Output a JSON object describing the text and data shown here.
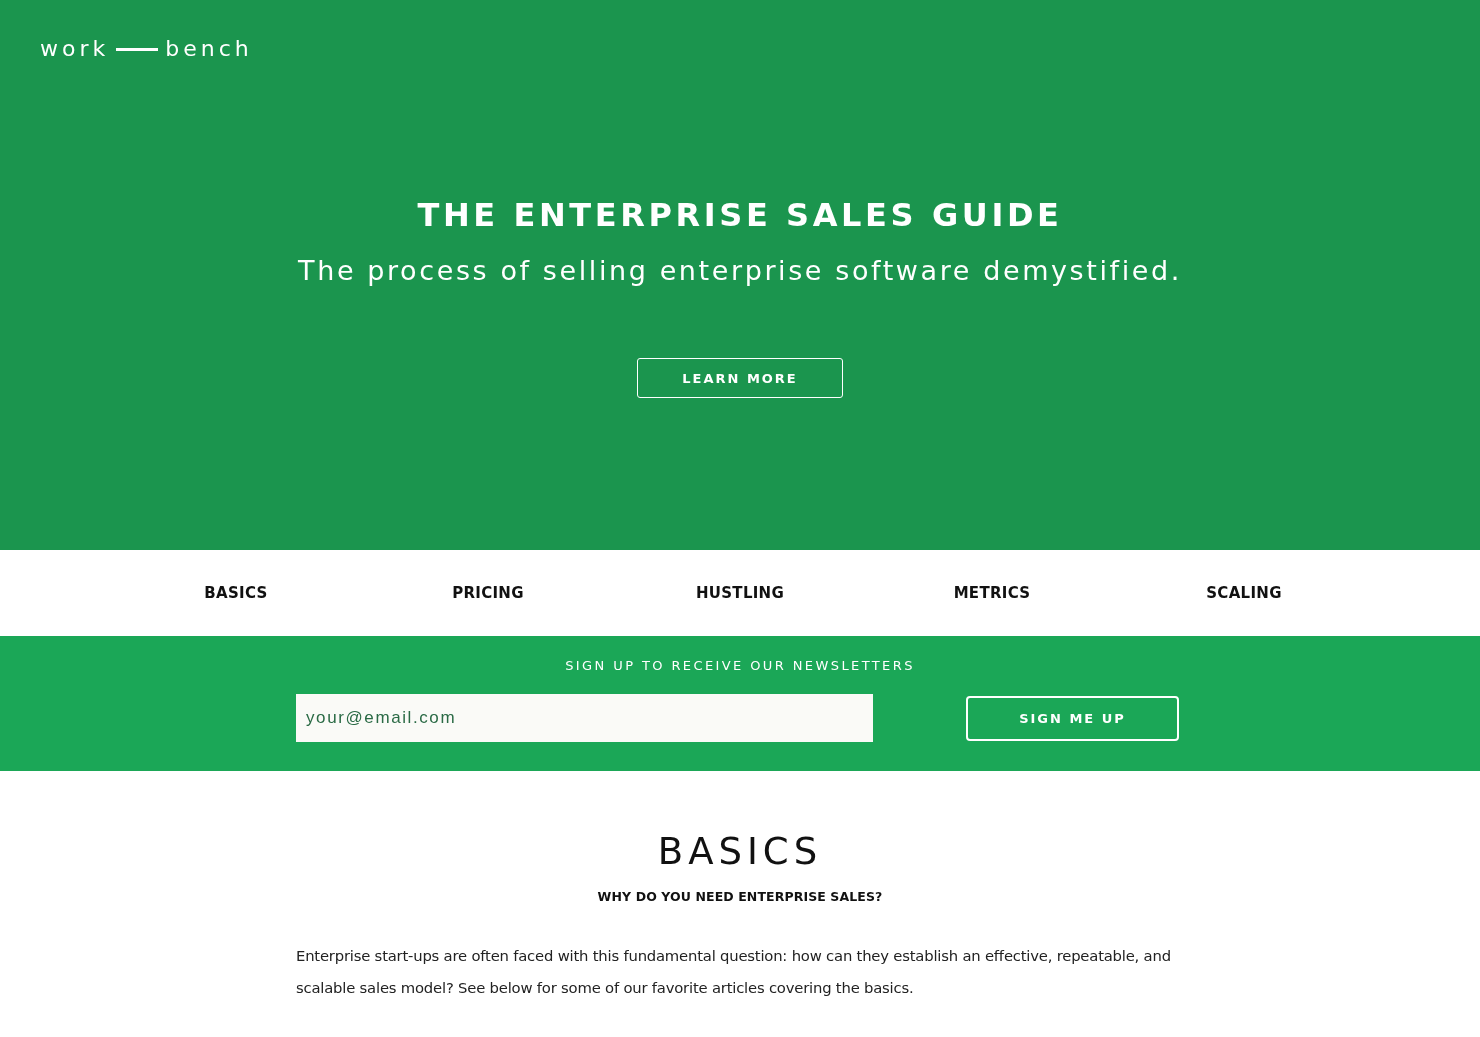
{
  "logo": {
    "left": "work",
    "right": "bench"
  },
  "hero": {
    "title": "THE ENTERPRISE SALES GUIDE",
    "subtitle": "The process of selling enterprise software demystified.",
    "button": "LEARN MORE"
  },
  "nav": {
    "items": [
      "BASICS",
      "PRICING",
      "HUSTLING",
      "METRICS",
      "SCALING"
    ]
  },
  "newsletter": {
    "heading": "SIGN UP TO RECEIVE OUR NEWSLETTERS",
    "email": {
      "placeholder": "your@email.com"
    },
    "button": "SIGN ME UP"
  },
  "section": {
    "title": "BASICS",
    "subtitle": "WHY DO YOU NEED ENTERPRISE SALES?",
    "paragraph": "Enterprise start-ups are often faced with this fundamental question: how can they establish an effective, repeatable, and scalable sales model? See below for some of our favorite articles covering the basics."
  }
}
